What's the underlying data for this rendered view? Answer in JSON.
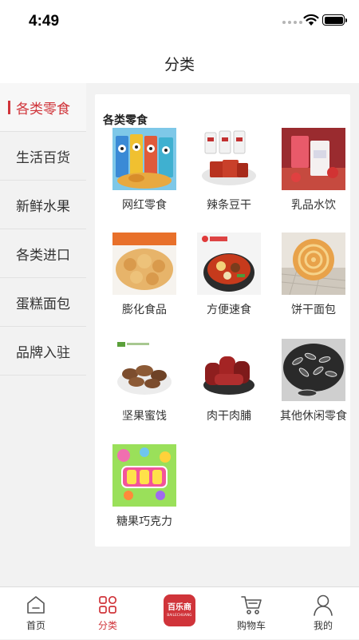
{
  "status_bar": {
    "time": "4:49"
  },
  "nav": {
    "title": "分类"
  },
  "sidebar": {
    "items": [
      {
        "label": "各类零食",
        "active": true
      },
      {
        "label": "生活百货",
        "active": false
      },
      {
        "label": "新鲜水果",
        "active": false
      },
      {
        "label": "各类进口",
        "active": false
      },
      {
        "label": "蛋糕面包",
        "active": false
      },
      {
        "label": "品牌入驻",
        "active": false
      }
    ]
  },
  "content": {
    "section_title": "各类零食",
    "items": [
      {
        "label": "网红零食"
      },
      {
        "label": "辣条豆干"
      },
      {
        "label": "乳品水饮"
      },
      {
        "label": "膨化食品"
      },
      {
        "label": "方便速食"
      },
      {
        "label": "饼干面包"
      },
      {
        "label": "坚果蜜饯"
      },
      {
        "label": "肉干肉脯"
      },
      {
        "label": "其他休闲零食"
      },
      {
        "label": "糖果巧克力"
      }
    ]
  },
  "tab_bar": {
    "items": [
      {
        "label": "首页",
        "icon": "home-icon",
        "active": false
      },
      {
        "label": "分类",
        "icon": "category-grid-icon",
        "active": true
      },
      {
        "label": "",
        "icon": "brand-logo",
        "active": false
      },
      {
        "label": "购物车",
        "icon": "cart-icon",
        "active": false
      },
      {
        "label": "我的",
        "icon": "profile-icon",
        "active": false
      }
    ],
    "brand_logo_text": "百乐商",
    "brand_logo_subtext": "BAILECHUANG"
  },
  "colors": {
    "accent": "#d0343a",
    "background": "#f2f2f2",
    "surface": "#ffffff"
  }
}
